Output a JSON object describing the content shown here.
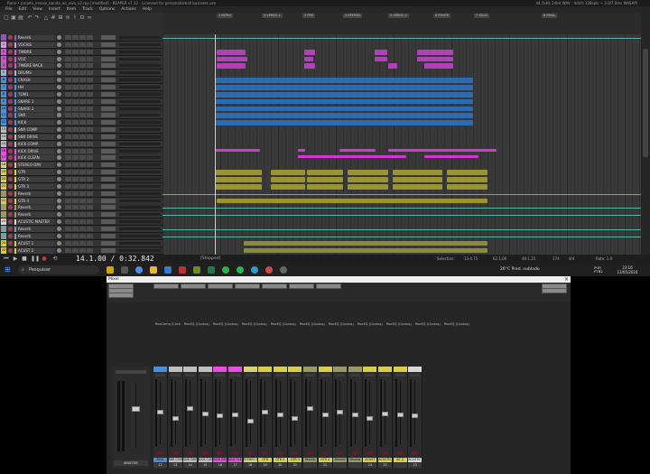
{
  "window": {
    "title": "Rune • projeto_ensaio_banda_ao_vivo_v2.rpp [modified] - REAPER v7.12 - Licensed for personal/small business use",
    "right_info": "44.1kHz 24bit WAV : 4/4ch 128spls ~ 3.0/7.0ms WASAPI"
  },
  "menu": [
    "File",
    "Edit",
    "View",
    "Insert",
    "Item",
    "Track",
    "Options",
    "Actions",
    "Help"
  ],
  "markers": [
    "1 INTRO",
    "2 VERSO 1",
    "3 PRE",
    "4 REFRÃO",
    "5 VERSO 2",
    "6 PONTE",
    "7 SOLO",
    "8 FINAL"
  ],
  "tracks": [
    {
      "num": "",
      "name": "Reverb",
      "color": "#8a5bb0"
    },
    {
      "num": "1",
      "name": "VOCAIS",
      "color": "#c8a2d6"
    },
    {
      "num": "2",
      "name": "TIMBRE",
      "color": "#c35ac9"
    },
    {
      "num": "3",
      "name": "VOZ",
      "color": "#c35ac9"
    },
    {
      "num": "4",
      "name": "TIMBRE BACK",
      "color": "#c35ac9"
    },
    {
      "num": "5",
      "name": "DRUMS",
      "color": "#9bb7d4"
    },
    {
      "num": "6",
      "name": "CRASH",
      "color": "#4a8fd8"
    },
    {
      "num": "7",
      "name": "HH",
      "color": "#4a8fd8"
    },
    {
      "num": "8",
      "name": "TOM1",
      "color": "#4a8fd8"
    },
    {
      "num": "9",
      "name": "SNARE 1",
      "color": "#4a8fd8"
    },
    {
      "num": "10",
      "name": "SNARE 2",
      "color": "#4a8fd8"
    },
    {
      "num": "11",
      "name": "SNR",
      "color": "#4a8fd8"
    },
    {
      "num": "12",
      "name": "KICK",
      "color": "#4a8fd8"
    },
    {
      "num": "13",
      "name": "SNR COMP",
      "color": "#bfbfbf"
    },
    {
      "num": "14",
      "name": "SNR DRIVE",
      "color": "#bfbfbf"
    },
    {
      "num": "15",
      "name": "KICK COMP",
      "color": "#bfbfbf"
    },
    {
      "num": "16",
      "name": "KICK DRIVE",
      "color": "#e84fe0"
    },
    {
      "num": "17",
      "name": "KICK CLEAN",
      "color": "#e84fe0"
    },
    {
      "num": "18",
      "name": "STEREO DRV",
      "color": "#d6d27a"
    },
    {
      "num": "19",
      "name": "GTR",
      "color": "#d6cf4a"
    },
    {
      "num": "20",
      "name": "GTR 2",
      "color": "#d6cf4a"
    },
    {
      "num": "21",
      "name": "GTR 3",
      "color": "#d6cf4a"
    },
    {
      "num": "",
      "name": "Reverb",
      "color": "#9a9a66"
    },
    {
      "num": "22",
      "name": "GTR 4",
      "color": "#d6cf4a"
    },
    {
      "num": "",
      "name": "Reverb",
      "color": "#9a9a66"
    },
    {
      "num": "",
      "name": "Reverb",
      "color": "#9a9a66"
    },
    {
      "num": "23",
      "name": "ACUSTIC MASTER",
      "color": "#d9d9d9"
    },
    {
      "num": "",
      "name": "Reverb",
      "color": "#7aa0a0"
    },
    {
      "num": "",
      "name": "Reverb",
      "color": "#7aa0a0"
    },
    {
      "num": "24",
      "name": "ACUST 1",
      "color": "#d6cf4a"
    },
    {
      "num": "25",
      "name": "ACUST 2",
      "color": "#d6cf4a"
    }
  ],
  "transport": {
    "time": "14.1.00 / 0:32.842",
    "state": "[Stopped]"
  },
  "status": {
    "selection": "Selection:",
    "sel_start": "13.4.75",
    "sel_end": "62.1.00",
    "length": "48.1.25",
    "bpm": "174",
    "sig": "4/4",
    "rate": "Rate: 1.0"
  },
  "taskbar": {
    "search_placeholder": "Pesquisar",
    "weather": "26°C  Pred. nublado",
    "lang": "POR PTB2",
    "time": "23:16",
    "date": "13/05/2024"
  },
  "mixer": {
    "title": "Mixer",
    "master_label": "MASTER",
    "inserts": [
      "ReaComp (Cockos)",
      "ReaEQ (Cockos)",
      "ReaEQ (Cockos)",
      "ReaEQ (Cockos)",
      "ReaEQ (Cockos)",
      "ReaEQ (Cockos)",
      "ReaEQ (Cockos)",
      "ReaEQ (Cockos)",
      "ReaEQ (Cockos)",
      "ReaEQ (Cockos)",
      "ReaEQ (Cockos)"
    ],
    "strips": [
      {
        "name": "KICK",
        "num": "12",
        "color": "#4a8fd8",
        "level": 0.55
      },
      {
        "name": "SNR COMP",
        "num": "13",
        "color": "#bfbfbf",
        "level": 0.45
      },
      {
        "name": "SNR DRIVE",
        "num": "14",
        "color": "#bfbfbf",
        "level": 0.6
      },
      {
        "name": "KICK COMP",
        "num": "15",
        "color": "#bfbfbf",
        "level": 0.52
      },
      {
        "name": "KICK DRIVE",
        "num": "16",
        "color": "#e84fe0",
        "level": 0.48
      },
      {
        "name": "KICK CLEAN",
        "num": "17",
        "color": "#e84fe0",
        "level": 0.5
      },
      {
        "name": "STEREO DRV",
        "num": "18",
        "color": "#d6d27a",
        "level": 0.4
      },
      {
        "name": "GTR",
        "num": "19",
        "color": "#d6cf4a",
        "level": 0.55
      },
      {
        "name": "GTR 2",
        "num": "20",
        "color": "#d6cf4a",
        "level": 0.5
      },
      {
        "name": "GTR 3",
        "num": "21",
        "color": "#d6cf4a",
        "level": 0.45
      },
      {
        "name": "Reverb",
        "num": "",
        "color": "#9a9a66",
        "level": 0.6
      },
      {
        "name": "GTR 4",
        "num": "22",
        "color": "#d6cf4a",
        "level": 0.5
      },
      {
        "name": "Reverb",
        "num": "",
        "color": "#9a9a66",
        "level": 0.55
      },
      {
        "name": "Reverb",
        "num": "",
        "color": "#9a9a66",
        "level": 0.5
      },
      {
        "name": "ACUST",
        "num": "24",
        "color": "#d6cf4a",
        "level": 0.45
      },
      {
        "name": "ACUSTIC",
        "num": "25",
        "color": "#d6cf4a",
        "level": 0.52
      },
      {
        "name": "AC 2",
        "num": "",
        "color": "#d6cf4a",
        "level": 0.5
      },
      {
        "name": "ACUSTIC BRUS",
        "num": "23",
        "color": "#d9d9d9",
        "level": 0.48
      }
    ]
  }
}
